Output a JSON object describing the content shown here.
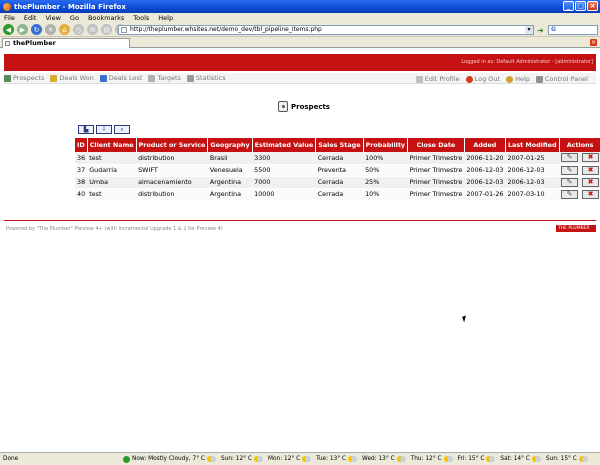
{
  "window": {
    "title": "thePlumber - Mozilla Firefox"
  },
  "menu": [
    "File",
    "Edit",
    "View",
    "Go",
    "Bookmarks",
    "Tools",
    "Help"
  ],
  "address": {
    "url": "http://theplumber.whsites.net/demo_dev/tbl_pipeline_items.php"
  },
  "tab": {
    "title": "thePlumber"
  },
  "header": {
    "logged": "Logged in as: Default Administrator - [administrator]"
  },
  "nav": {
    "left": [
      "Prospects",
      "Deals Won",
      "Deals Lost",
      "Targets",
      "Statistics"
    ],
    "right": [
      "Edit Profile",
      "Log Out",
      "Help",
      "Control Panel"
    ]
  },
  "page": {
    "title": "Prospects"
  },
  "table": {
    "headers": [
      "ID",
      "Client Name",
      "Product or Service",
      "Geography",
      "Estimated Value",
      "Sales Stage",
      "Probability",
      "Close Date",
      "Added",
      "Last Modified",
      "Actions"
    ],
    "rows": [
      [
        "36",
        "test",
        "distribution",
        "Brasil",
        "3300",
        "Cerrada",
        "100%",
        "Primer Trimestre",
        "2006-11-20",
        "2007-01-25"
      ],
      [
        "37",
        "Gudarria",
        "SWIFT",
        "Venesuela",
        "5500",
        "Preventa",
        "50%",
        "Primer Trimestre",
        "2006-12-03",
        "2006-12-03"
      ],
      [
        "38",
        "Umba",
        "almacenamiento",
        "Argentina",
        "7000",
        "Cerrada",
        "25%",
        "Primer Trimestre",
        "2006-12-03",
        "2006-12-03"
      ],
      [
        "40",
        "test",
        "distribution",
        "Argentina",
        "10000",
        "Cerrada",
        "10%",
        "Primer Trimestre",
        "2007-01-26",
        "2007-03-10"
      ]
    ]
  },
  "footer": {
    "text": "Powered by \"The Plumber\" Preview 4+ (with Incremental Upgrade 1 & 2 for Preview 4)",
    "badge": "THE PLUMBER"
  },
  "status": {
    "done": "Done",
    "now": "Now: Mostly Cloudy, 7° C",
    "forecast": [
      "Sun: 12° C",
      "Mon: 12° C",
      "Tue: 13° C",
      "Wed: 13° C",
      "Thu: 12° C",
      "Fri: 15° C",
      "Sat: 14° C",
      "Sun: 15° C"
    ]
  },
  "colors": {
    "brand": "#c51111",
    "chrome": "#ece9d8"
  }
}
